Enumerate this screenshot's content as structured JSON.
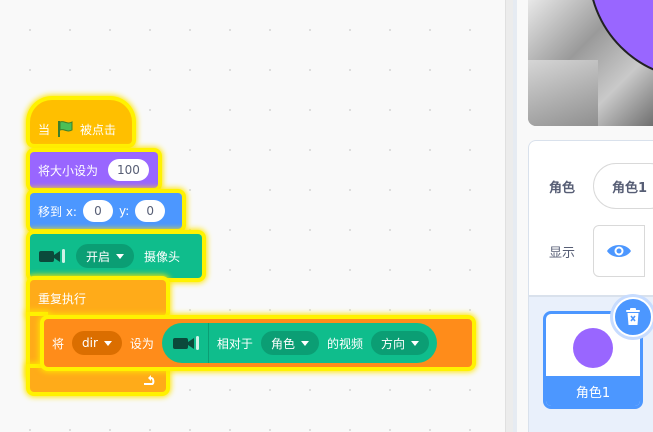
{
  "blocks": {
    "hat": {
      "prefix": "当",
      "suffix": "被点击"
    },
    "set_size": {
      "label": "将大小设为",
      "value": "100"
    },
    "goto": {
      "label": "移到 x:",
      "x": "0",
      "ylabel": "y:",
      "y": "0"
    },
    "video": {
      "value": "开启",
      "suffix": "摄像头"
    },
    "repeat": {
      "label": "重复执行"
    },
    "set_var": {
      "prefix": "将",
      "var": "dir",
      "middle": "设为",
      "relative_label": "相对于",
      "target": "角色",
      "video_label": "的视频",
      "attribute": "方向"
    }
  },
  "sprite_info": {
    "sprite_label": "角色",
    "sprite_name": "角色1",
    "show_label": "显示"
  },
  "sprite_list": {
    "items": [
      {
        "name": "角色1",
        "color": "#9966ff"
      }
    ]
  },
  "colors": {
    "events": "#ffbf00",
    "looks": "#9966ff",
    "motion": "#4c97ff",
    "video": "#0fbd8c",
    "control": "#ffab19",
    "variables": "#ff8c1a",
    "highlight": "#fff200"
  }
}
